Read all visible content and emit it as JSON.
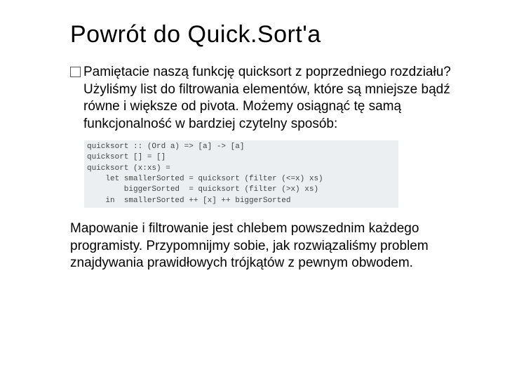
{
  "title": "Powrót do Quick.Sort'a",
  "bullet_lead": "Pamiętacie",
  "bullet_rest": " naszą funkcję quicksort z poprzedniego rozdziału? Użyliśmy list do filtrowania elementów, które są mniejsze bądź równe i większe od pivota. Możemy osiągnąć tę samą funkcjonalność w bardziej czytelny sposób:",
  "code": "quicksort :: (Ord a) => [a] -> [a]\nquicksort [] = []\nquicksort (x:xs) =\n    let smallerSorted = quicksort (filter (<=x) xs)\n        biggerSorted  = quicksort (filter (>x) xs)\n    in  smallerSorted ++ [x] ++ biggerSorted",
  "closing": "Mapowanie i filtrowanie jest chlebem powszednim każdego programisty. Przypomnijmy sobie, jak rozwiązaliśmy problem znajdywania prawidłowych trójkątów z pewnym obwodem."
}
